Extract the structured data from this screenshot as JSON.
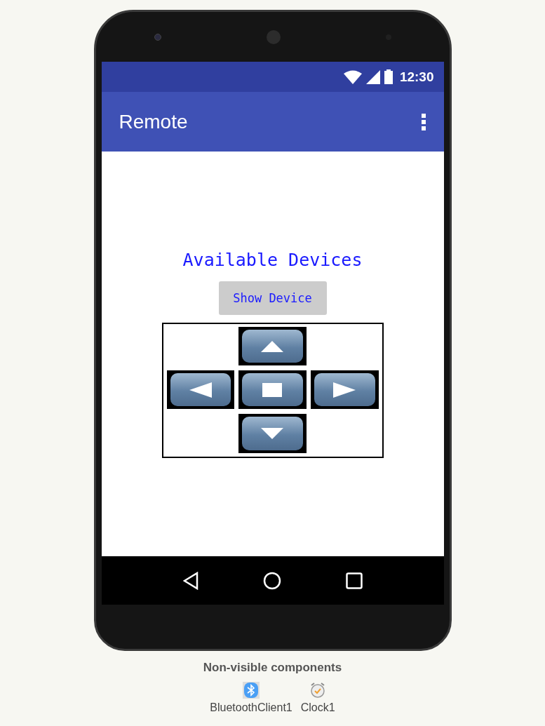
{
  "status_bar": {
    "time": "12:30"
  },
  "app_bar": {
    "title": "Remote"
  },
  "heading": "Available Devices",
  "show_button": {
    "label": "Show Device"
  },
  "dpad": [
    {
      "kind": "up"
    },
    {
      "kind": "left"
    },
    {
      "kind": "stop"
    },
    {
      "kind": "right"
    },
    {
      "kind": "down"
    }
  ],
  "non_visible": {
    "title": "Non-visible components",
    "components": [
      {
        "kind": "bluetooth",
        "label": "BluetoothClient1"
      },
      {
        "kind": "clock",
        "label": "Clock1"
      }
    ]
  }
}
